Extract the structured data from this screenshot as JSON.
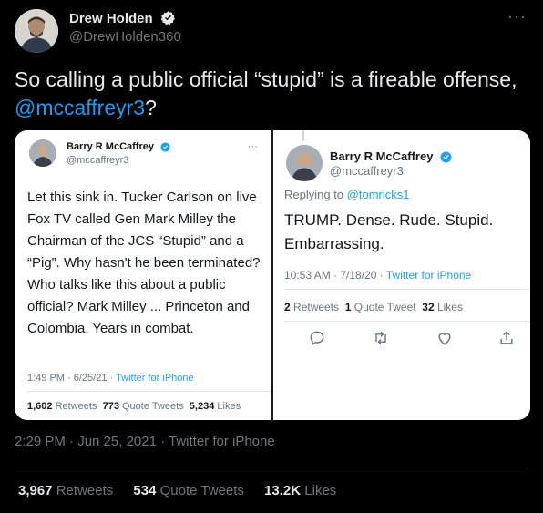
{
  "tweet": {
    "author_name": "Drew Holden",
    "author_handle": "@DrewHolden360",
    "more_label": "···",
    "text": "So calling a public official “stupid” is a fireable offense,",
    "mention": "@mccaffreyr3",
    "text_end": "?",
    "timestamp": "2:29 PM · Jun 25, 2021 · Twitter for iPhone",
    "retweets_count": "3,967",
    "retweets_label": "Retweets",
    "quotes_count": "534",
    "quotes_label": "Quote Tweets",
    "likes_count": "13.2K",
    "likes_label": "Likes"
  },
  "left_card": {
    "name": "Barry R McCaffrey",
    "handle": "@mccaffreyr3",
    "more_label": "···",
    "body": "Let this sink in. Tucker Carlson on live Fox TV called Gen Mark Milley the Chairman of the JCS “Stupid” and a “Pig”. Why hasn't he been terminated? Who talks like this about a public official? Mark Milley ... Princeton and Colombia. Years in combat.",
    "time": "1:49 PM · 6/25/21 · ",
    "source": "Twitter for iPhone",
    "retweets_count": "1,602",
    "retweets_label": "Retweets",
    "quotes_count": "773",
    "quotes_label": "Quote Tweets",
    "likes_count": "5,234",
    "likes_label": "Likes"
  },
  "right_card": {
    "name": "Barry R McCaffrey",
    "handle": "@mccaffreyr3",
    "replying_prefix": "Replying to ",
    "replying_to": "@tomricks1",
    "body": "TRUMP. Dense. Rude. Stupid. Embarrassing.",
    "time": "10:53 AM · 7/18/20 · ",
    "source": "Twitter for iPhone",
    "retweets_count": "2",
    "retweets_label": "Retweets",
    "quotes_count": "1",
    "quotes_label": "Quote Tweet",
    "likes_count": "32",
    "likes_label": "Likes"
  },
  "colors": {
    "accent": "#1d9bf0",
    "background": "#000000",
    "verified": "#1d9bf0"
  }
}
